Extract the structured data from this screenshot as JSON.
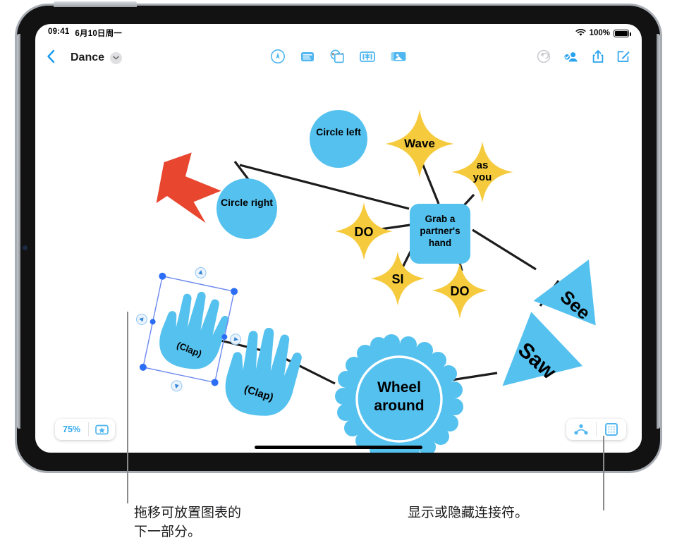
{
  "status_bar": {
    "time": "09:41",
    "date": "6月10日周一",
    "wifi_icon": "wifi-icon",
    "battery_percent": "100%",
    "battery_icon": "battery-full-icon"
  },
  "nav_bar": {
    "back_icon": "back-chevron-icon",
    "title": "Dance",
    "title_chevron_icon": "chevron-down-icon",
    "more_dots": "•••",
    "center_tools": [
      {
        "name": "markup-pen-icon",
        "label": "Markup"
      },
      {
        "name": "text-box-icon",
        "label": "Text Box"
      },
      {
        "name": "shapes-icon",
        "label": "Shapes"
      },
      {
        "name": "sticker-icon",
        "label": "Sticker"
      },
      {
        "name": "media-icon",
        "label": "Media"
      }
    ],
    "right_tools": [
      {
        "name": "undo-icon",
        "label": "Undo",
        "disabled": true
      },
      {
        "name": "collaborate-icon",
        "label": "Collaborate"
      },
      {
        "name": "share-icon",
        "label": "Share"
      },
      {
        "name": "compose-icon",
        "label": "Compose"
      }
    ]
  },
  "canvas": {
    "nodes": [
      {
        "id": "circle-left",
        "label": "Circle left",
        "shape": "circle",
        "color": "#55c1ef"
      },
      {
        "id": "circle-right",
        "label": "Circle right",
        "shape": "circle",
        "color": "#55c1ef"
      },
      {
        "id": "wave",
        "label": "Wave",
        "shape": "four-point-star",
        "color": "#f5cb3d"
      },
      {
        "id": "as-you",
        "label": "as you",
        "shape": "four-point-star",
        "color": "#f5cb3d"
      },
      {
        "id": "grab-hand",
        "label": "Grab a partner's hand",
        "shape": "rounded-rect",
        "color": "#55c1ef"
      },
      {
        "id": "do-left",
        "label": "DO",
        "shape": "four-point-star",
        "color": "#f5cb3d"
      },
      {
        "id": "si",
        "label": "SI",
        "shape": "four-point-star",
        "color": "#f5cb3d"
      },
      {
        "id": "do-right",
        "label": "DO",
        "shape": "four-point-star",
        "color": "#f5cb3d"
      },
      {
        "id": "see",
        "label": "See",
        "shape": "triangle",
        "color": "#55c1ef"
      },
      {
        "id": "saw",
        "label": "Saw",
        "shape": "triangle",
        "color": "#55c1ef"
      },
      {
        "id": "wheel-around",
        "label": "Wheel around",
        "shape": "scalloped-circle",
        "color": "#55c1ef"
      },
      {
        "id": "clap-selected",
        "label": "(Clap)",
        "shape": "hand",
        "color": "#55c1ef"
      },
      {
        "id": "clap-two",
        "label": "(Clap)",
        "shape": "hand",
        "color": "#55c1ef"
      },
      {
        "id": "red-arrow",
        "label": "",
        "shape": "arrow",
        "color": "#e8462f"
      }
    ],
    "labels": {
      "circle_left": "Circle left",
      "circle_right": "Circle right",
      "wave": "Wave",
      "as_you_line1": "as",
      "as_you_line2": "you",
      "grab_line1": "Grab a",
      "grab_line2": "partner's",
      "grab_line3": "hand",
      "do_left": "DO",
      "si": "SI",
      "do_right": "DO",
      "see": "See",
      "saw": "Saw",
      "wheel_line1": "Wheel",
      "wheel_line2": "around",
      "clap_one": "(Clap)",
      "clap_two": "(Clap)"
    },
    "selection": {
      "target": "clap-selected",
      "handle_color": "#2b6ef5",
      "box_color": "#6b88ef"
    }
  },
  "bottom_bar": {
    "zoom_value": "75%",
    "zoom_star_icon": "star-badge-icon",
    "connector_toggle_icon": "connector-graph-icon",
    "frame_icon": "frame-grid-icon"
  },
  "callouts": {
    "left_line1": "拖移可放置图表的",
    "left_line2": "下一部分。",
    "right": "显示或隐藏连接符。"
  },
  "colors": {
    "accent_blue": "#30a8ef",
    "shape_blue": "#55c1ef",
    "shape_yellow": "#f5cb3d",
    "arrow_red": "#e8462f",
    "connector": "#1c1c1e"
  }
}
